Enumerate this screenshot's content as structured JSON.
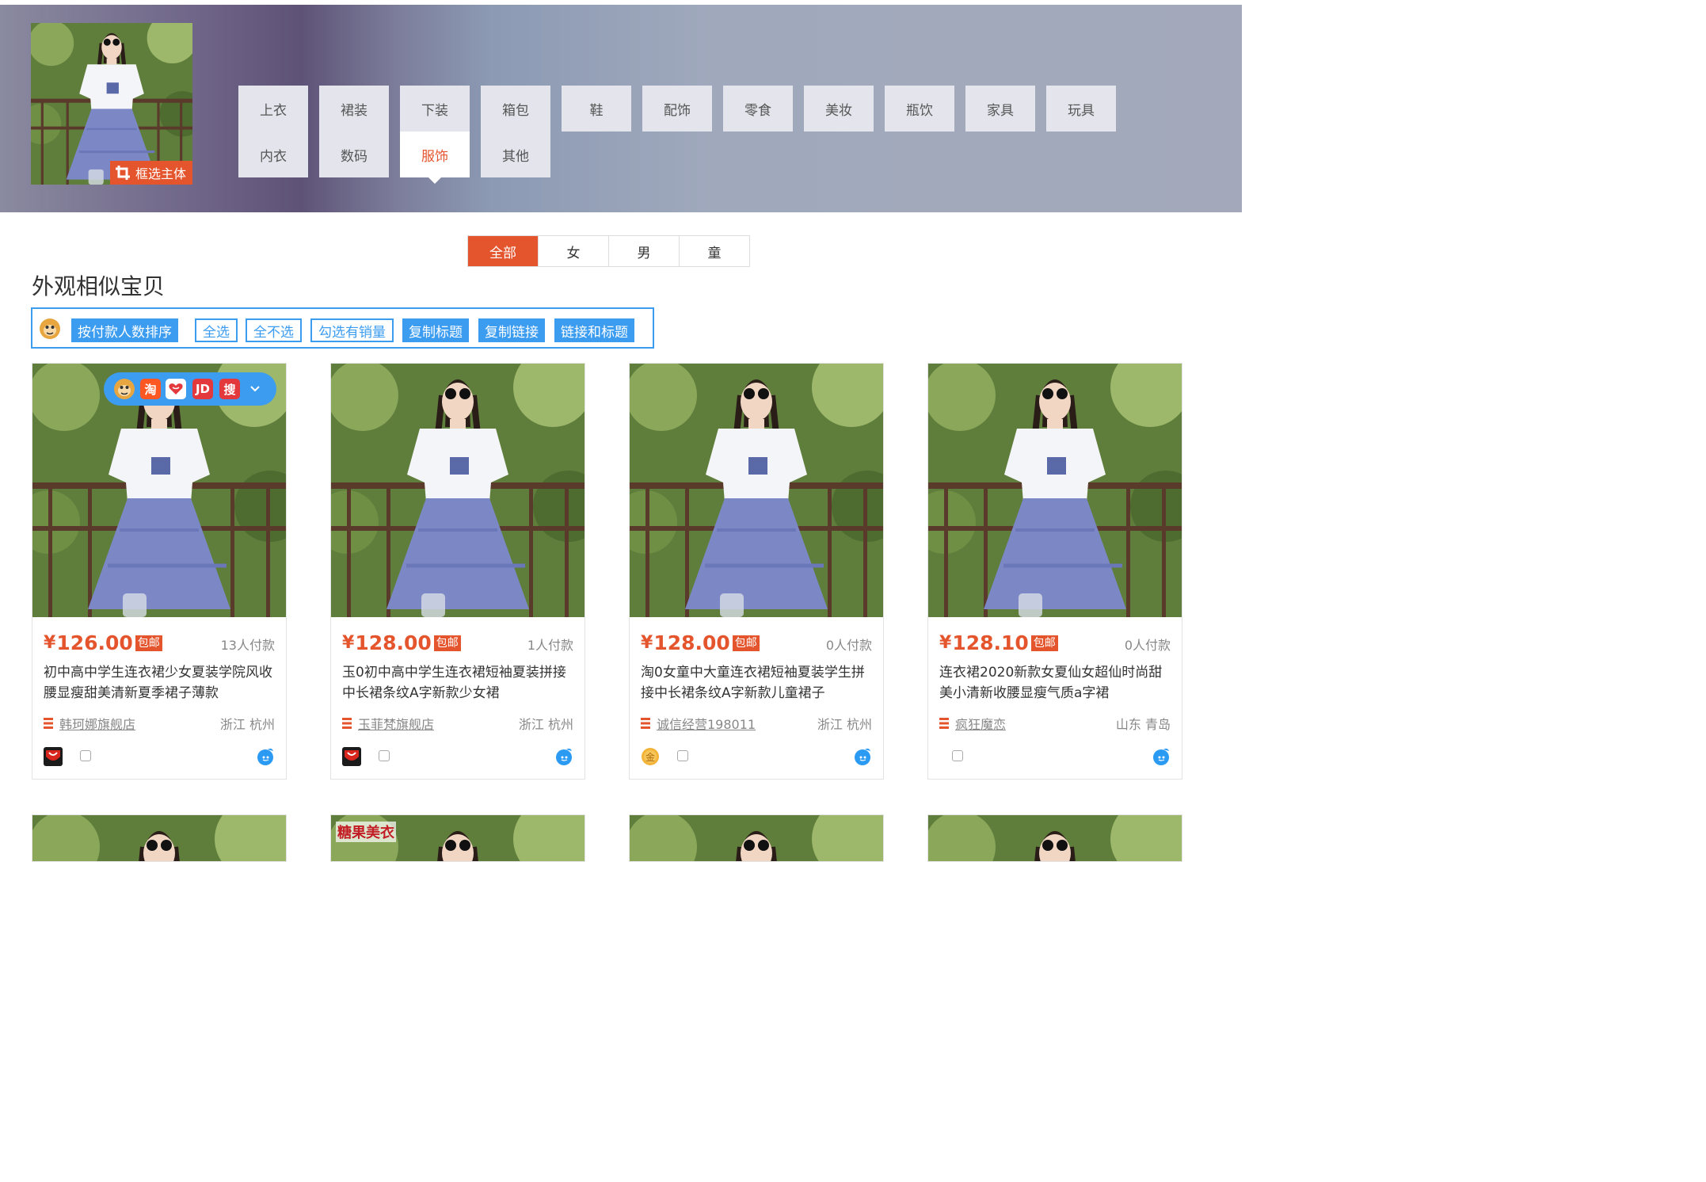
{
  "query": {
    "crop_label": "框选主体"
  },
  "categories": [
    {
      "label": "上衣",
      "active": false
    },
    {
      "label": "裙装",
      "active": false
    },
    {
      "label": "下装",
      "active": false
    },
    {
      "label": "箱包",
      "active": false
    },
    {
      "label": "鞋",
      "active": false
    },
    {
      "label": "配饰",
      "active": false
    },
    {
      "label": "零食",
      "active": false
    },
    {
      "label": "美妆",
      "active": false
    },
    {
      "label": "瓶饮",
      "active": false
    },
    {
      "label": "家具",
      "active": false
    },
    {
      "label": "玩具",
      "active": false
    },
    {
      "label": "内衣",
      "active": false
    },
    {
      "label": "数码",
      "active": false
    },
    {
      "label": "服饰",
      "active": true
    },
    {
      "label": "其他",
      "active": false
    }
  ],
  "gender_tabs": [
    "全部",
    "女",
    "男",
    "童"
  ],
  "section_title": "外观相似宝贝",
  "toolbar": {
    "sort_label": "按付款人数排序",
    "select_all": "全选",
    "select_none": "全不选",
    "select_sold": "勾选有销量",
    "copy_title": "复制标题",
    "copy_link": "复制链接",
    "link_and_title": "链接和标题"
  },
  "float_bar": {
    "icons": [
      "淘",
      "JD",
      "搜"
    ]
  },
  "currency": "¥",
  "free_shipping": "包邮",
  "products": [
    {
      "price": "126.00",
      "sales": "13人付款",
      "title": "初中高中学生连衣裙少女夏装学院风收腰显瘦甜美清新夏季裙子薄款",
      "shop": "韩珂娜旗舰店",
      "location": "浙江 杭州",
      "logo": "tmall"
    },
    {
      "price": "128.00",
      "sales": "1人付款",
      "title": "玉0初中高中学生连衣裙短袖夏装拼接中长裙条纹A字新款少女裙",
      "shop": "玉菲梵旗舰店",
      "location": "浙江 杭州",
      "logo": "tmall"
    },
    {
      "price": "128.00",
      "sales": "0人付款",
      "title": "淘0女童中大童连衣裙短袖夏装学生拼接中长裙条纹A字新款儿童裙子",
      "shop": "诚信经营198011",
      "location": "浙江 杭州",
      "logo": "gold"
    },
    {
      "price": "128.10",
      "sales": "0人付款",
      "title": "连衣裙2020新款女夏仙女超仙时尚甜美小清新收腰显瘦气质a字裙",
      "shop": "疯狂魔恋",
      "location": "山东 青岛",
      "logo": "none"
    }
  ],
  "row2_watermark": "糖果美衣",
  "colors": {
    "accent": "#e4552d",
    "blue": "#3b9cf0"
  }
}
